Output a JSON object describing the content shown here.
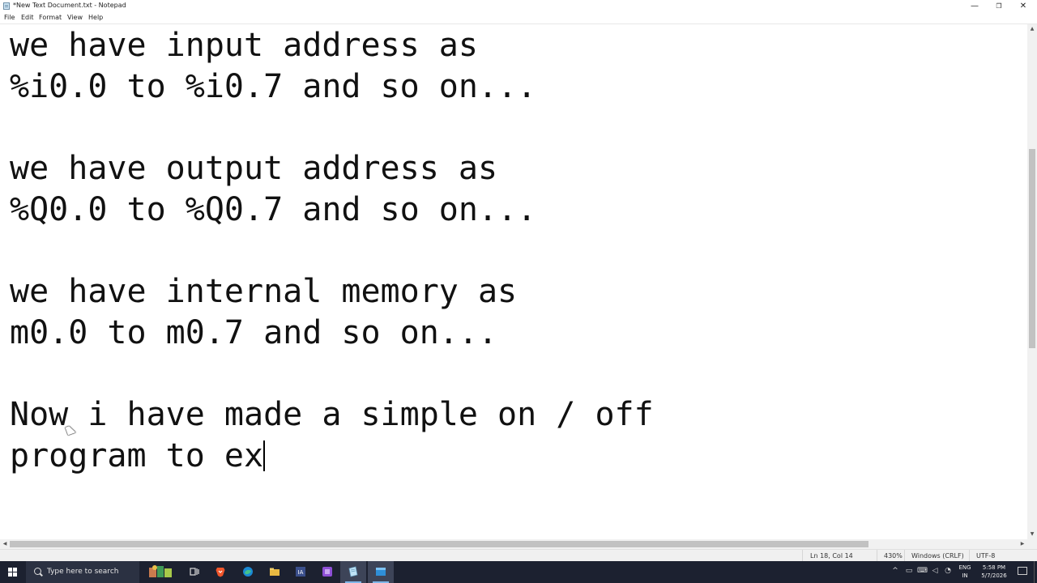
{
  "window": {
    "title": "*New Text Document.txt - Notepad",
    "minimize": "—",
    "maximize": "❐",
    "close": "✕"
  },
  "menu": [
    "File",
    "Edit",
    "Format",
    "View",
    "Help"
  ],
  "editor": {
    "lines": [
      "we have input address as",
      "%i0.0 to %i0.7 and so on...",
      "",
      "we have output address as",
      "%Q0.0 to %Q0.7 and so on...",
      "",
      "we have internal memory as",
      "m0.0 to m0.7 and so on...",
      "",
      "Now i have made a simple on / off",
      "program to ex"
    ]
  },
  "status": {
    "position": "Ln 18, Col 14",
    "zoom": "430%",
    "line_ending": "Windows (CRLF)",
    "encoding": "UTF-8"
  },
  "taskbar": {
    "search_placeholder": "Type here to search",
    "apps": [
      "weather-widget",
      "task-view",
      "brave-browser",
      "edge-browser",
      "file-explorer",
      "codesys",
      "visual-studio",
      "notepad",
      "app-window"
    ],
    "tray": {
      "language_top": "ENG",
      "language_bottom": "IN",
      "time": "5:58 PM",
      "date": "5/7/2026"
    }
  },
  "colors": {
    "taskbar_bg": "#1c2130",
    "accent": "#7fb6e9",
    "status_bg": "#f0f0f0"
  }
}
